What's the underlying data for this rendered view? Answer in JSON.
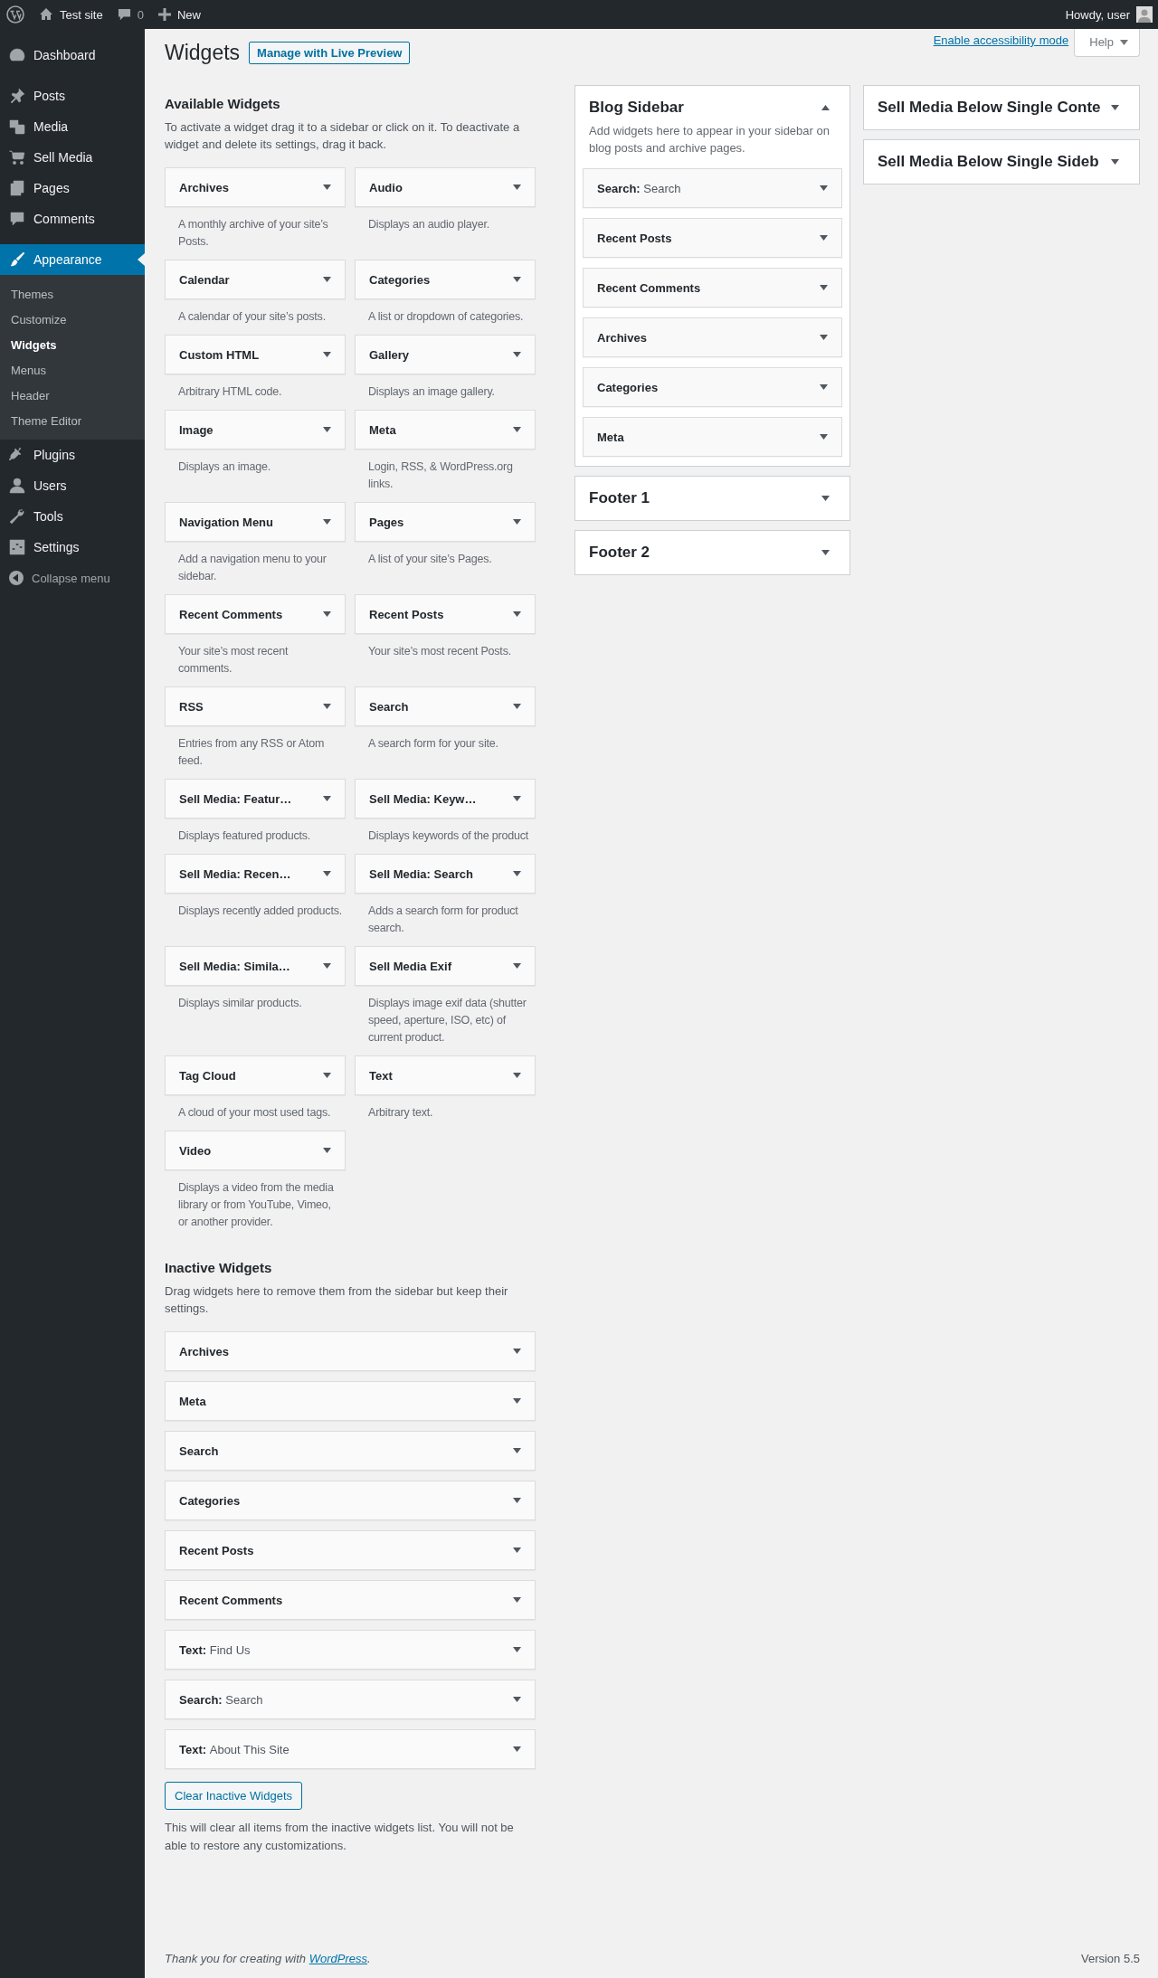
{
  "admin_bar": {
    "site_name": "Test site",
    "comments_count": "0",
    "new_label": "New",
    "greeting": "Howdy, user"
  },
  "menu_groups": [
    [
      {
        "label": "Dashboard",
        "selected": false
      }
    ],
    [
      {
        "label": "Posts",
        "selected": false
      },
      {
        "label": "Media",
        "selected": false
      },
      {
        "label": "Sell Media",
        "selected": false
      },
      {
        "label": "Pages",
        "selected": false
      },
      {
        "label": "Comments",
        "selected": false
      }
    ],
    [
      {
        "label": "Appearance",
        "selected": true,
        "children": [
          {
            "label": "Themes",
            "selected": false
          },
          {
            "label": "Customize",
            "selected": false
          },
          {
            "label": "Widgets",
            "selected": true
          },
          {
            "label": "Menus",
            "selected": false
          },
          {
            "label": "Header",
            "selected": false
          },
          {
            "label": "Theme Editor",
            "selected": false
          }
        ]
      },
      {
        "label": "Plugins",
        "selected": false
      },
      {
        "label": "Users",
        "selected": false
      },
      {
        "label": "Tools",
        "selected": false
      },
      {
        "label": "Settings",
        "selected": false
      }
    ]
  ],
  "collapse_label": "Collapse menu",
  "screen_meta": {
    "accessibility_link": "Enable accessibility mode",
    "help_label": "Help"
  },
  "page_title": "Widgets",
  "live_preview_button": "Manage with Live Preview",
  "available": {
    "heading": "Available Widgets",
    "description": "To activate a widget drag it to a sidebar or click on it. To deactivate a widget and delete its settings, drag it back.",
    "widgets": [
      {
        "title": "Archives",
        "description": "A monthly archive of your site’s Posts."
      },
      {
        "title": "Audio",
        "description": "Displays an audio player."
      },
      {
        "title": "Calendar",
        "description": "A calendar of your site’s posts."
      },
      {
        "title": "Categories",
        "description": "A list or dropdown of categories."
      },
      {
        "title": "Custom HTML",
        "description": "Arbitrary HTML code."
      },
      {
        "title": "Gallery",
        "description": "Displays an image gallery."
      },
      {
        "title": "Image",
        "description": "Displays an image."
      },
      {
        "title": "Meta",
        "description": "Login, RSS, & WordPress.org links."
      },
      {
        "title": "Navigation Menu",
        "description": "Add a navigation menu to your sidebar."
      },
      {
        "title": "Pages",
        "description": "A list of your site’s Pages."
      },
      {
        "title": "Recent Comments",
        "description": "Your site’s most recent comments."
      },
      {
        "title": "Recent Posts",
        "description": "Your site’s most recent Posts."
      },
      {
        "title": "RSS",
        "description": "Entries from any RSS or Atom feed."
      },
      {
        "title": "Search",
        "description": "A search form for your site."
      },
      {
        "title": "Sell Media: Featur…",
        "description": "Displays featured products."
      },
      {
        "title": "Sell Media: Keyw…",
        "description": "Displays keywords of the product"
      },
      {
        "title": "Sell Media: Recen…",
        "description": "Displays recently added products."
      },
      {
        "title": "Sell Media: Search",
        "description": "Adds a search form for product search."
      },
      {
        "title": "Sell Media: Simila…",
        "description": "Displays similar products."
      },
      {
        "title": "Sell Media Exif",
        "description": "Displays image exif data (shutter speed, aperture, ISO, etc) of current product."
      },
      {
        "title": "Tag Cloud",
        "description": "A cloud of your most used tags."
      },
      {
        "title": "Text",
        "description": "Arbitrary text."
      },
      {
        "title": "Video",
        "description": "Displays a video from the media library or from YouTube, Vimeo, or another provider."
      }
    ]
  },
  "inactive": {
    "heading": "Inactive Widgets",
    "description": "Drag widgets here to remove them from the sidebar but keep their settings.",
    "widgets": [
      {
        "title": "Archives"
      },
      {
        "title": "Meta"
      },
      {
        "title": "Search"
      },
      {
        "title": "Categories"
      },
      {
        "title": "Recent Posts"
      },
      {
        "title": "Recent Comments"
      },
      {
        "title": "Text:",
        "in_title": "Find Us"
      },
      {
        "title": "Search:",
        "in_title": "Search"
      },
      {
        "title": "Text:",
        "in_title": "About This Site"
      }
    ],
    "clear_button": "Clear Inactive Widgets",
    "note": "This will clear all items from the inactive widgets list. You will not be able to restore any customizations."
  },
  "sidebar_columns": [
    [
      {
        "title": "Blog Sidebar",
        "expanded": true,
        "description": "Add widgets here to appear in your sidebar on blog posts and archive pages.",
        "widgets": [
          {
            "title": "Search:",
            "in_title": "Search"
          },
          {
            "title": "Recent Posts"
          },
          {
            "title": "Recent Comments"
          },
          {
            "title": "Archives"
          },
          {
            "title": "Categories"
          },
          {
            "title": "Meta"
          }
        ]
      },
      {
        "title": "Footer 1",
        "expanded": false
      },
      {
        "title": "Footer 2",
        "expanded": false
      }
    ],
    [
      {
        "title": "Sell Media Below Single Conte",
        "expanded": false
      },
      {
        "title": "Sell Media Below Single Sideb",
        "expanded": false
      }
    ]
  ],
  "footer": {
    "thanks_prefix": "Thank you for creating with ",
    "thanks_link": "WordPress",
    "thanks_suffix": ".",
    "version": "Version 5.5"
  }
}
